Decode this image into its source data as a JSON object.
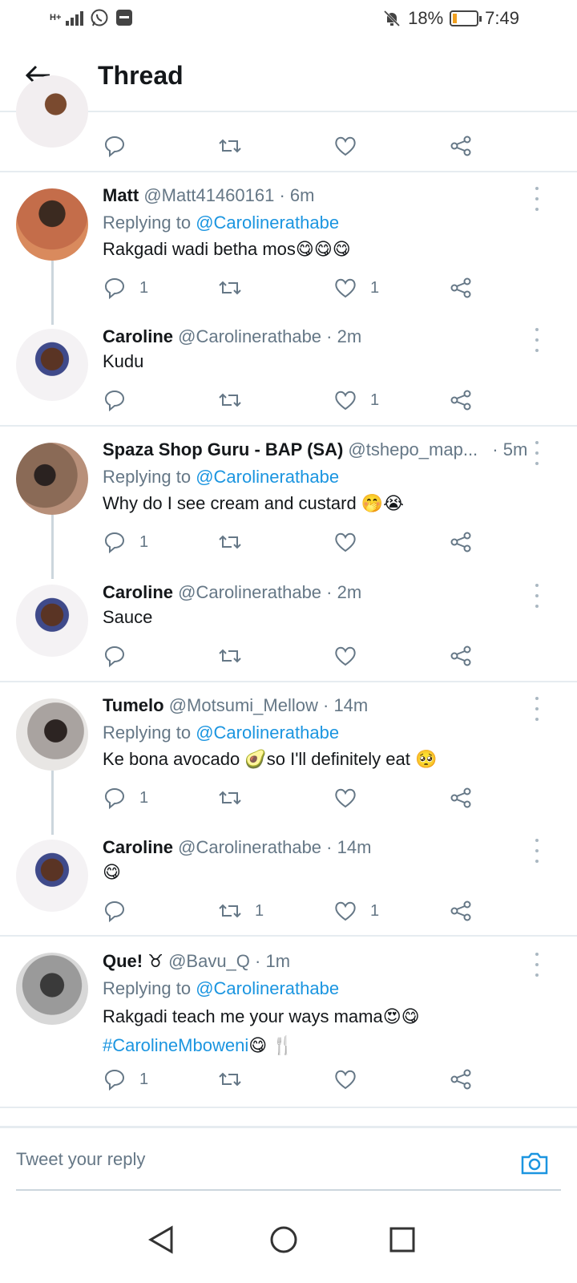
{
  "status_bar": {
    "network": "H+",
    "battery_percent": "18%",
    "time": "7:49",
    "icons": [
      "signal-icon",
      "whatsapp-icon",
      "huawei-icon",
      "mute-icon",
      "battery-icon"
    ]
  },
  "header": {
    "title": "Thread"
  },
  "tweets": [
    {
      "name": "Matt",
      "handle": "@Matt41460161",
      "time": "· 6m",
      "reply_prefix": "Replying to",
      "reply_to": "@Carolinerathabe",
      "text": "Rakgadi wadi betha mos😋😋😋",
      "replies": "1",
      "retweets": "",
      "likes": "1"
    },
    {
      "name": "Caroline",
      "handle": "@Carolinerathabe",
      "time": "· 2m",
      "text": "Kudu",
      "replies": "",
      "retweets": "",
      "likes": "1"
    },
    {
      "name": "Spaza Shop Guru - BAP (SA)",
      "handle": "@tshepo_map...",
      "time": "· 5m",
      "reply_prefix": "Replying to",
      "reply_to": "@Carolinerathabe",
      "text": "Why do I see cream and custard 🤭😭",
      "replies": "1",
      "retweets": "",
      "likes": ""
    },
    {
      "name": "Caroline",
      "handle": "@Carolinerathabe",
      "time": "· 2m",
      "text": "Sauce",
      "replies": "",
      "retweets": "",
      "likes": ""
    },
    {
      "name": "Tumelo",
      "handle": "@Motsumi_Mellow",
      "time": "· 14m",
      "reply_prefix": "Replying to",
      "reply_to": "@Carolinerathabe",
      "text": "Ke bona avocado 🥑so I'll definitely eat 🥺",
      "replies": "1",
      "retweets": "",
      "likes": ""
    },
    {
      "name": "Caroline",
      "handle": "@Carolinerathabe",
      "time": "· 14m",
      "text": "😋",
      "replies": "",
      "retweets": "1",
      "likes": "1"
    },
    {
      "name": "Que! ♉",
      "handle": "@Bavu_Q",
      "time": "· 1m",
      "reply_prefix": "Replying to",
      "reply_to": "@Carolinerathabe",
      "text": "Rakgadi teach me your ways mama😍😋",
      "hashtag": "#CarolineMboweni",
      "text_after": "😋 🍴",
      "replies": "1",
      "retweets": "",
      "likes": ""
    }
  ],
  "reply_bar": {
    "placeholder": "Tweet your reply"
  },
  "colors": {
    "link": "#1b95e0",
    "secondary_text": "#657786",
    "divider": "#e6ecf0"
  }
}
